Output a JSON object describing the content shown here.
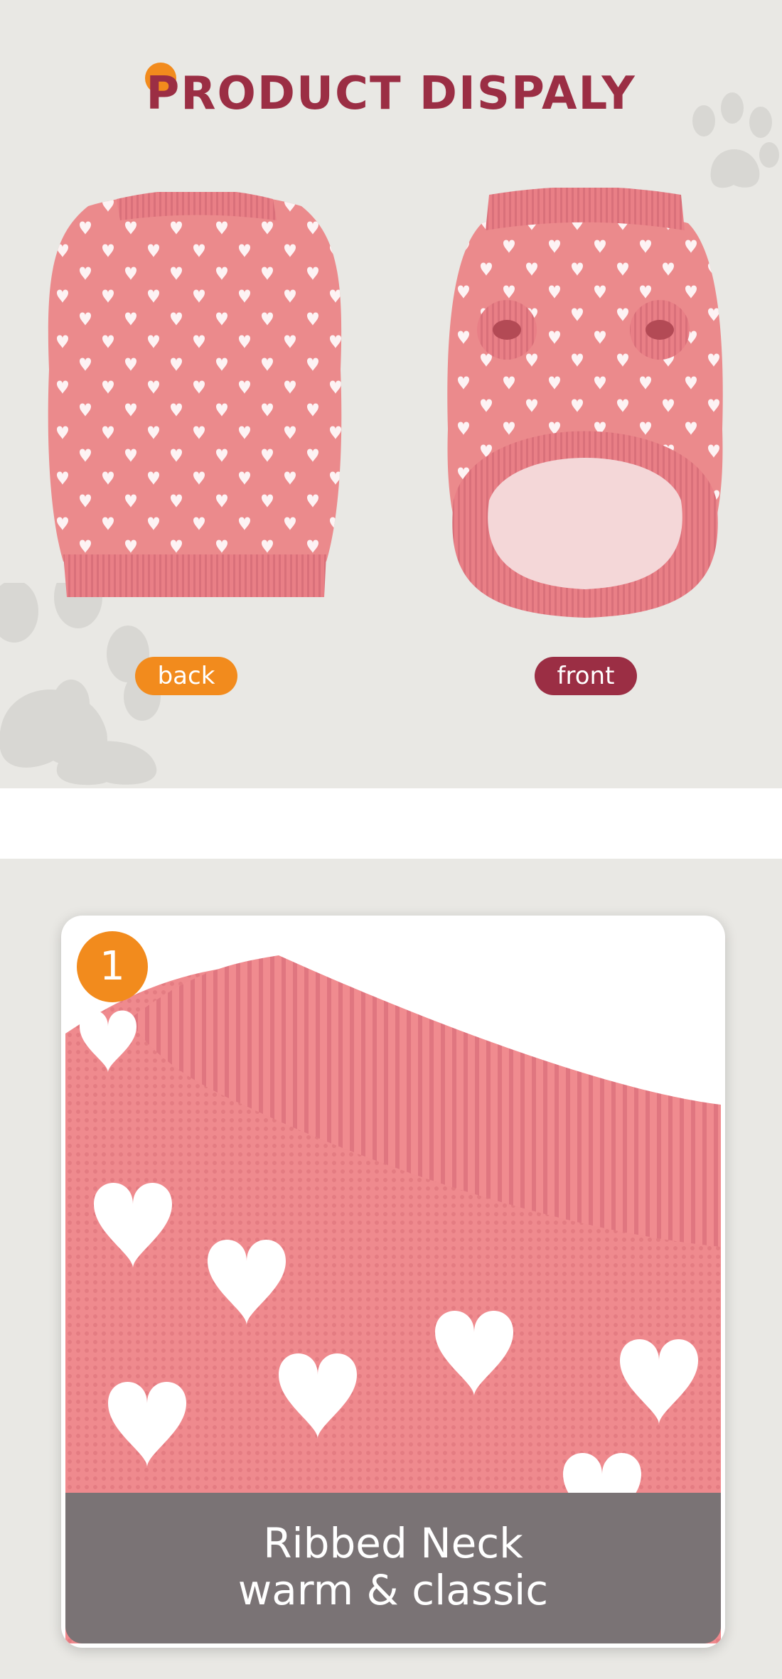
{
  "display": {
    "title": "PRODUCT DISPALY",
    "back_label": "back",
    "front_label": "front"
  },
  "feature": {
    "number": "1",
    "caption_line1": "Ribbed Neck",
    "caption_line2": "warm & classic"
  },
  "colors": {
    "background": "#e9e8e4",
    "title": "#9b2e44",
    "accent_orange": "#f28b1d",
    "accent_wine": "#9b2e44",
    "sweater_pink": "#eb8a8c",
    "caption_bar": "#7a7375"
  },
  "icons": [
    "paw-print-icon"
  ]
}
